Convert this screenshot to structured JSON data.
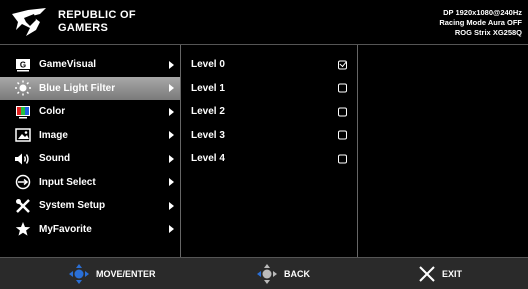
{
  "header": {
    "brand_line1": "REPUBLIC OF",
    "brand_line2": "GAMERS",
    "status_line1": "DP 1920x1080@240Hz",
    "status_line2": "Racing Mode  Aura OFF",
    "status_line3": "ROG Strix XG258Q"
  },
  "menu": [
    {
      "label": "GameVisual",
      "icon": "gamevisual-icon"
    },
    {
      "label": "Blue Light Filter",
      "icon": "blue-light-icon"
    },
    {
      "label": "Color",
      "icon": "color-icon"
    },
    {
      "label": "Image",
      "icon": "image-icon"
    },
    {
      "label": "Sound",
      "icon": "sound-icon"
    },
    {
      "label": "Input Select",
      "icon": "input-select-icon"
    },
    {
      "label": "System Setup",
      "icon": "system-setup-icon"
    },
    {
      "label": "MyFavorite",
      "icon": "star-icon"
    }
  ],
  "selected_menu_index": 1,
  "options": [
    {
      "label": "Level 0",
      "checked": true
    },
    {
      "label": "Level 1",
      "checked": false
    },
    {
      "label": "Level 2",
      "checked": false
    },
    {
      "label": "Level 3",
      "checked": false
    },
    {
      "label": "Level 4",
      "checked": false
    }
  ],
  "footer": {
    "move_enter": "MOVE/ENTER",
    "back": "BACK",
    "exit": "EXIT"
  },
  "colors": {
    "background": "#000000",
    "selected_bg": "#8a8a8a",
    "footer_bg": "#2a2a2a",
    "joystick_blue": "#2a6fd6"
  }
}
